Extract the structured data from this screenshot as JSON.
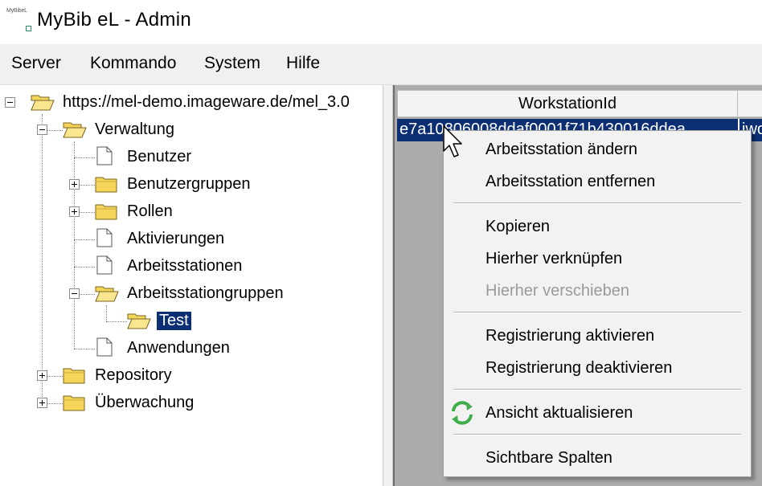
{
  "window": {
    "title": "MyBib eL - Admin",
    "logo_text": "MyBibeL"
  },
  "menubar": {
    "items": [
      "Server",
      "Kommando",
      "System",
      "Hilfe"
    ]
  },
  "tree": {
    "root": "https://mel-demo.imageware.de/mel_3.0",
    "verwaltung": "Verwaltung",
    "benutzer": "Benutzer",
    "benutzergruppen": "Benutzergruppen",
    "rollen": "Rollen",
    "aktivierungen": "Aktivierungen",
    "arbeitsstationen": "Arbeitsstationen",
    "arbeitsstationgruppen": "Arbeitsstationgruppen",
    "test": "Test",
    "anwendungen": "Anwendungen",
    "repository": "Repository",
    "ueberwachung": "Überwachung"
  },
  "grid": {
    "columns": [
      "WorkstationId",
      ""
    ],
    "rows": [
      {
        "workstation_id": "e7a10806008ddaf0001f71b430016ddea",
        "next": "iwo"
      }
    ]
  },
  "context_menu": {
    "change_ws": "Arbeitsstation ändern",
    "remove_ws": "Arbeitsstation entfernen",
    "copy": "Kopieren",
    "link_here": "Hierher verknüpfen",
    "move_here": "Hierher verschieben",
    "reg_activate": "Registrierung aktivieren",
    "reg_deactivate": "Registrierung deaktivieren",
    "refresh": "Ansicht aktualisieren",
    "visible_columns": "Sichtbare Spalten"
  },
  "colors": {
    "selection": "#0c2f74",
    "folder_fill": "#f5d65a",
    "grid_background": "#ababab",
    "menu_background": "#f0f0f0"
  }
}
